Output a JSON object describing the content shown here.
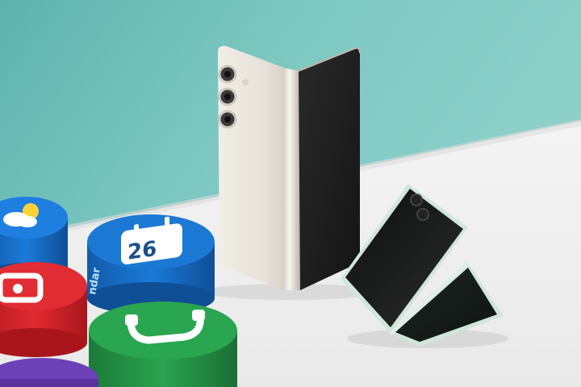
{
  "scene": {
    "colors": {
      "wall": "#79c5be",
      "wall_light": "#8fd2cb",
      "table": "#f2f2f2",
      "cream_phone": "#ece8e0",
      "dark_screen": "#1c1c1c",
      "mint_phone": "#cfe6dc",
      "weather_cylinder": "#1d6fd6",
      "calendar_cylinder": "#1a73c9",
      "red_cylinder": "#d9232b",
      "green_cylinder": "#26984a",
      "purple_cylinder": "#6a3fb5"
    },
    "calendar_icon": {
      "day": "26"
    },
    "cylinder_side_text": "ndar",
    "icons": [
      "weather-icon",
      "calendar-icon",
      "camera-icon",
      "phone-icon"
    ]
  }
}
